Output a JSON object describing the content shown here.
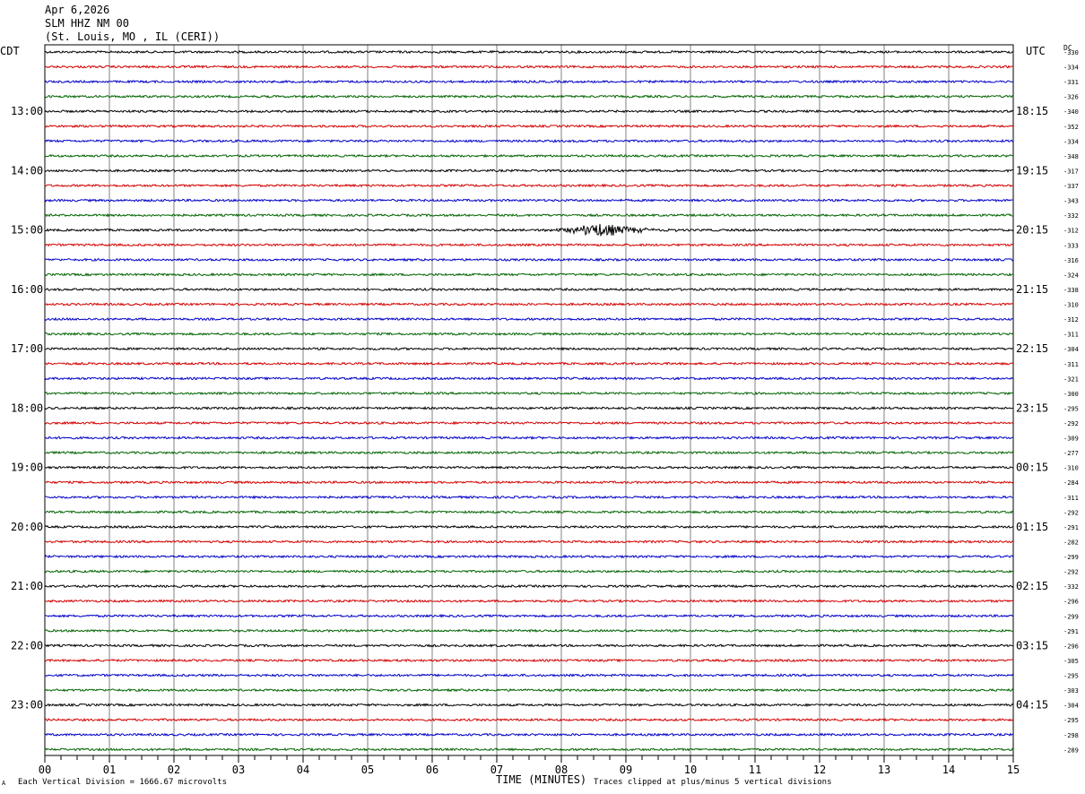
{
  "header": {
    "date": "Apr 6,2026",
    "station": "SLM HHZ NM 00",
    "location": "(St. Louis, MO , IL (CERI))"
  },
  "labels": {
    "left_zone": "CDT",
    "right_zone": "UTC",
    "dc": "DC",
    "xlabel": "TIME (MINUTES)",
    "footer_left": "Each Vertical Division = 1666.67 microvolts",
    "footer_right": "Traces clipped at plus/minus 5 vertical divisions",
    "corner_mark": "A"
  },
  "colors": {
    "line_cycle": [
      "#000000",
      "#d40000",
      "#0000c8",
      "#006400"
    ],
    "grid": "#808080",
    "frame": "#000000"
  },
  "chart_data": {
    "type": "line",
    "title": "SLM HHZ NM 00",
    "xlabel": "TIME (MINUTES)",
    "xlim": [
      0,
      15
    ],
    "x_ticks": [
      "00",
      "01",
      "02",
      "03",
      "04",
      "05",
      "06",
      "07",
      "08",
      "09",
      "10",
      "11",
      "12",
      "13",
      "14",
      "15"
    ],
    "grid": true,
    "minutes_per_line": 15,
    "line_count": 48,
    "left_hour_labels": [
      "13:00",
      "14:00",
      "15:00",
      "16:00",
      "17:00",
      "18:00",
      "19:00",
      "20:00",
      "21:00",
      "22:00",
      "23:00"
    ],
    "right_hour_labels": [
      "18:15",
      "19:15",
      "20:15",
      "21:15",
      "22:15",
      "23:15",
      "00:15",
      "01:15",
      "02:15",
      "03:15",
      "04:15"
    ],
    "dc_offsets": [
      -330,
      -334,
      -331,
      -326,
      -340,
      -352,
      -334,
      -348,
      -317,
      -337,
      -343,
      -332,
      -312,
      -333,
      -316,
      -324,
      -338,
      -310,
      -312,
      -311,
      -304,
      -311,
      -321,
      -300,
      -295,
      -292,
      -309,
      -277,
      -310,
      -284,
      -311,
      -292,
      -291,
      -282,
      -299,
      -292,
      -332,
      -296,
      -299,
      -291,
      -296,
      -305,
      -295,
      -303,
      -304,
      -295,
      -298,
      -289
    ],
    "events": [
      {
        "line_index": 12,
        "start_minute": 7.3,
        "peak_minute": 8.6,
        "end_minute": 10.5,
        "peak_amplitude_divisions": 0.8
      }
    ]
  }
}
